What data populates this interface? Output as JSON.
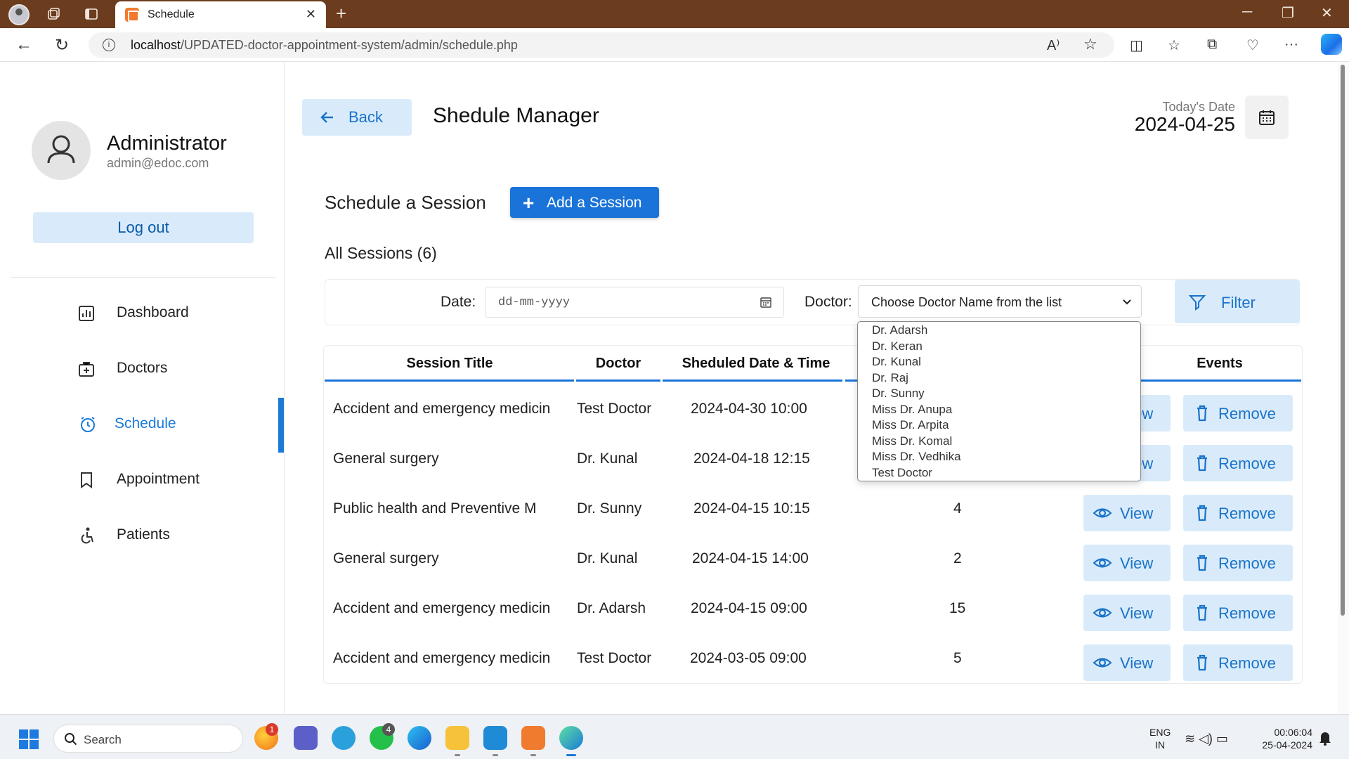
{
  "browser": {
    "tab_title": "Schedule",
    "url_host": "localhost",
    "url_path": "/UPDATED-doctor-appointment-system/admin/schedule.php"
  },
  "sidebar": {
    "profile_name": "Administrator",
    "profile_email": "admin@edoc.com",
    "logout_label": "Log out",
    "menu": [
      {
        "label": "Dashboard",
        "icon": "dashboard-icon"
      },
      {
        "label": "Doctors",
        "icon": "doctors-icon"
      },
      {
        "label": "Schedule",
        "icon": "schedule-icon",
        "active": true
      },
      {
        "label": "Appointment",
        "icon": "bookmark-icon"
      },
      {
        "label": "Patients",
        "icon": "patients-icon"
      }
    ]
  },
  "header": {
    "back_label": "Back",
    "title": "Shedule Manager",
    "date_caption": "Today's Date",
    "date_value": "2024-04-25"
  },
  "schedule": {
    "section_title": "Schedule a Session",
    "add_label": "Add a Session",
    "all_sessions": "All Sessions (6)"
  },
  "filter": {
    "date_label": "Date:",
    "date_placeholder": "dd-mm-yyyy",
    "doctor_label": "Doctor:",
    "doctor_selected": "Choose Doctor Name from the list",
    "filter_label": "Filter",
    "doctor_options": [
      "Dr. Adarsh",
      "Dr. Keran",
      "Dr. Kunal",
      "Dr. Raj",
      "Dr. Sunny",
      "Miss Dr. Anupa",
      "Miss Dr. Arpita",
      "Miss Dr. Komal",
      "Miss Dr. Vedhika",
      "Test Doctor"
    ]
  },
  "table": {
    "headers": [
      "Session Title",
      "Doctor",
      "Sheduled Date & Time",
      "Events"
    ],
    "view_label": "View",
    "remove_label": "Remove",
    "rows": [
      {
        "title": "Accident and emergency medicin",
        "doctor": "Test Doctor",
        "datetime": "2024-04-30 10:00",
        "count": ""
      },
      {
        "title": "General surgery",
        "doctor": "Dr. Kunal",
        "datetime": "2024-04-18 12:15",
        "count": ""
      },
      {
        "title": "Public health and Preventive M",
        "doctor": "Dr. Sunny",
        "datetime": "2024-04-15 10:15",
        "count": "4"
      },
      {
        "title": "General surgery",
        "doctor": "Dr. Kunal",
        "datetime": "2024-04-15 14:00",
        "count": "2"
      },
      {
        "title": "Accident and emergency medicin",
        "doctor": "Dr. Adarsh",
        "datetime": "2024-04-15 09:00",
        "count": "15"
      },
      {
        "title": "Accident and emergency medicin",
        "doctor": "Test Doctor",
        "datetime": "2024-03-05 09:00",
        "count": "5"
      }
    ]
  },
  "taskbar": {
    "search_label": "Search",
    "lang_1": "ENG",
    "lang_2": "IN",
    "time": "00:06:04",
    "date": "25-04-2024",
    "badge_1": "1",
    "badge_2": "4"
  },
  "colors": {
    "accent": "#1a73d8",
    "accent_light": "#d9ebfb",
    "titlebar": "#6b3c1e"
  }
}
